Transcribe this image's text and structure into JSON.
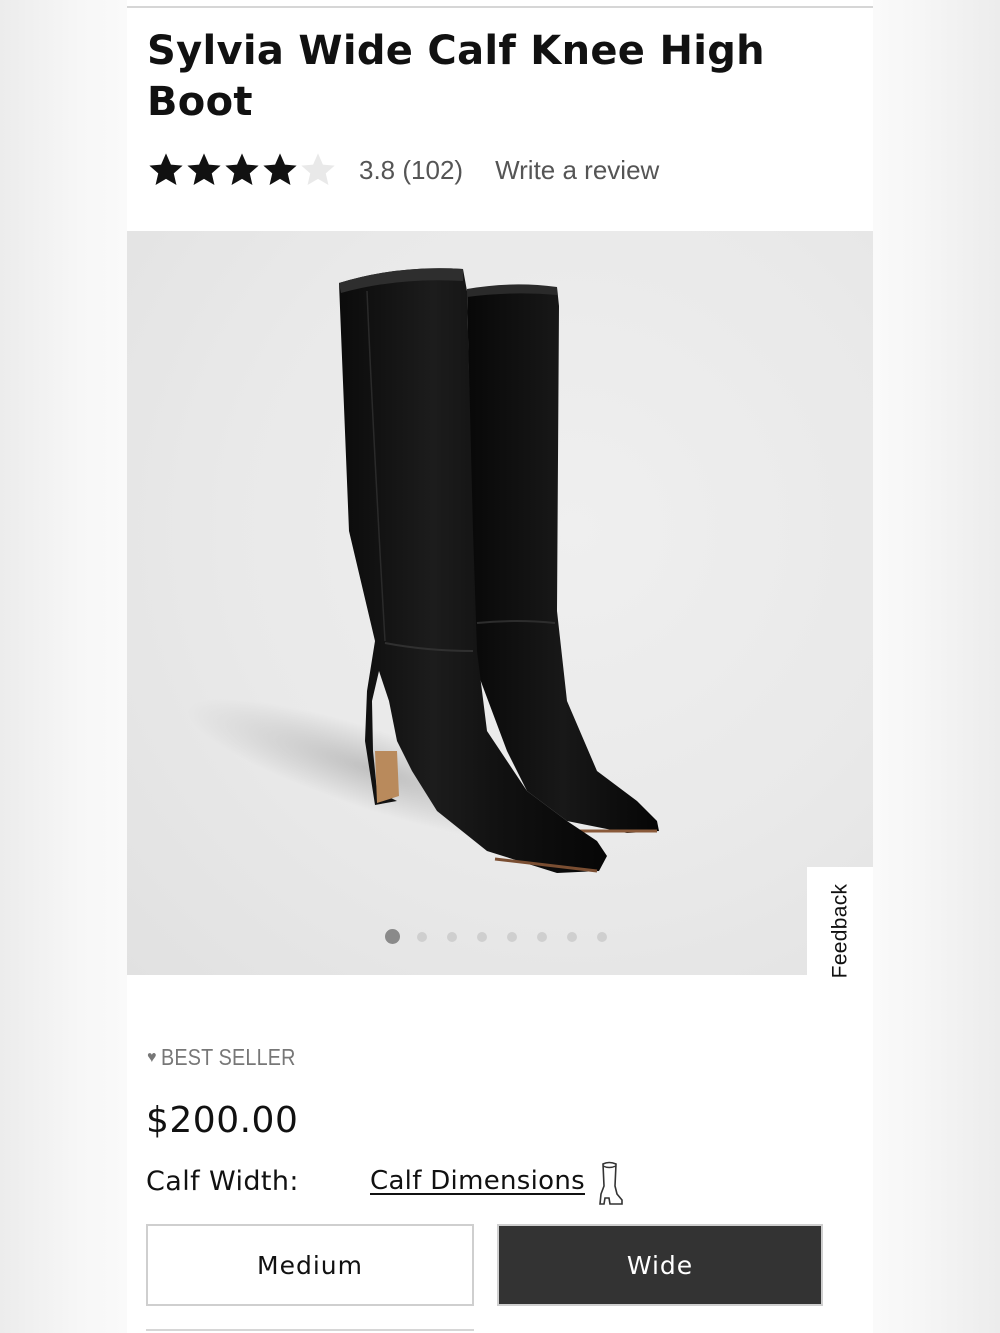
{
  "product": {
    "title": "Sylvia Wide Calf Knee High Boot",
    "rating_value": 3.8,
    "rating_text": "3.8 (102)",
    "write_review": "Write a review",
    "badge": "BEST SELLER",
    "price": "$200.00"
  },
  "gallery": {
    "image_subject": "black leather knee high boots",
    "dot_count": 8,
    "active_index": 0
  },
  "feedback": {
    "label": "Feedback"
  },
  "calf": {
    "label": "Calf Width:",
    "dimensions_link": "Calf Dimensions",
    "options": [
      "Medium",
      "Wide"
    ],
    "selected": "Wide"
  },
  "colors": {
    "selected_option_bg": "#333333",
    "star_filled": "#111111",
    "star_empty": "#e6e6e6",
    "muted_text": "#555555",
    "badge_text": "#777777"
  },
  "icons": [
    "star-icon",
    "heart-icon",
    "boot-icon"
  ]
}
